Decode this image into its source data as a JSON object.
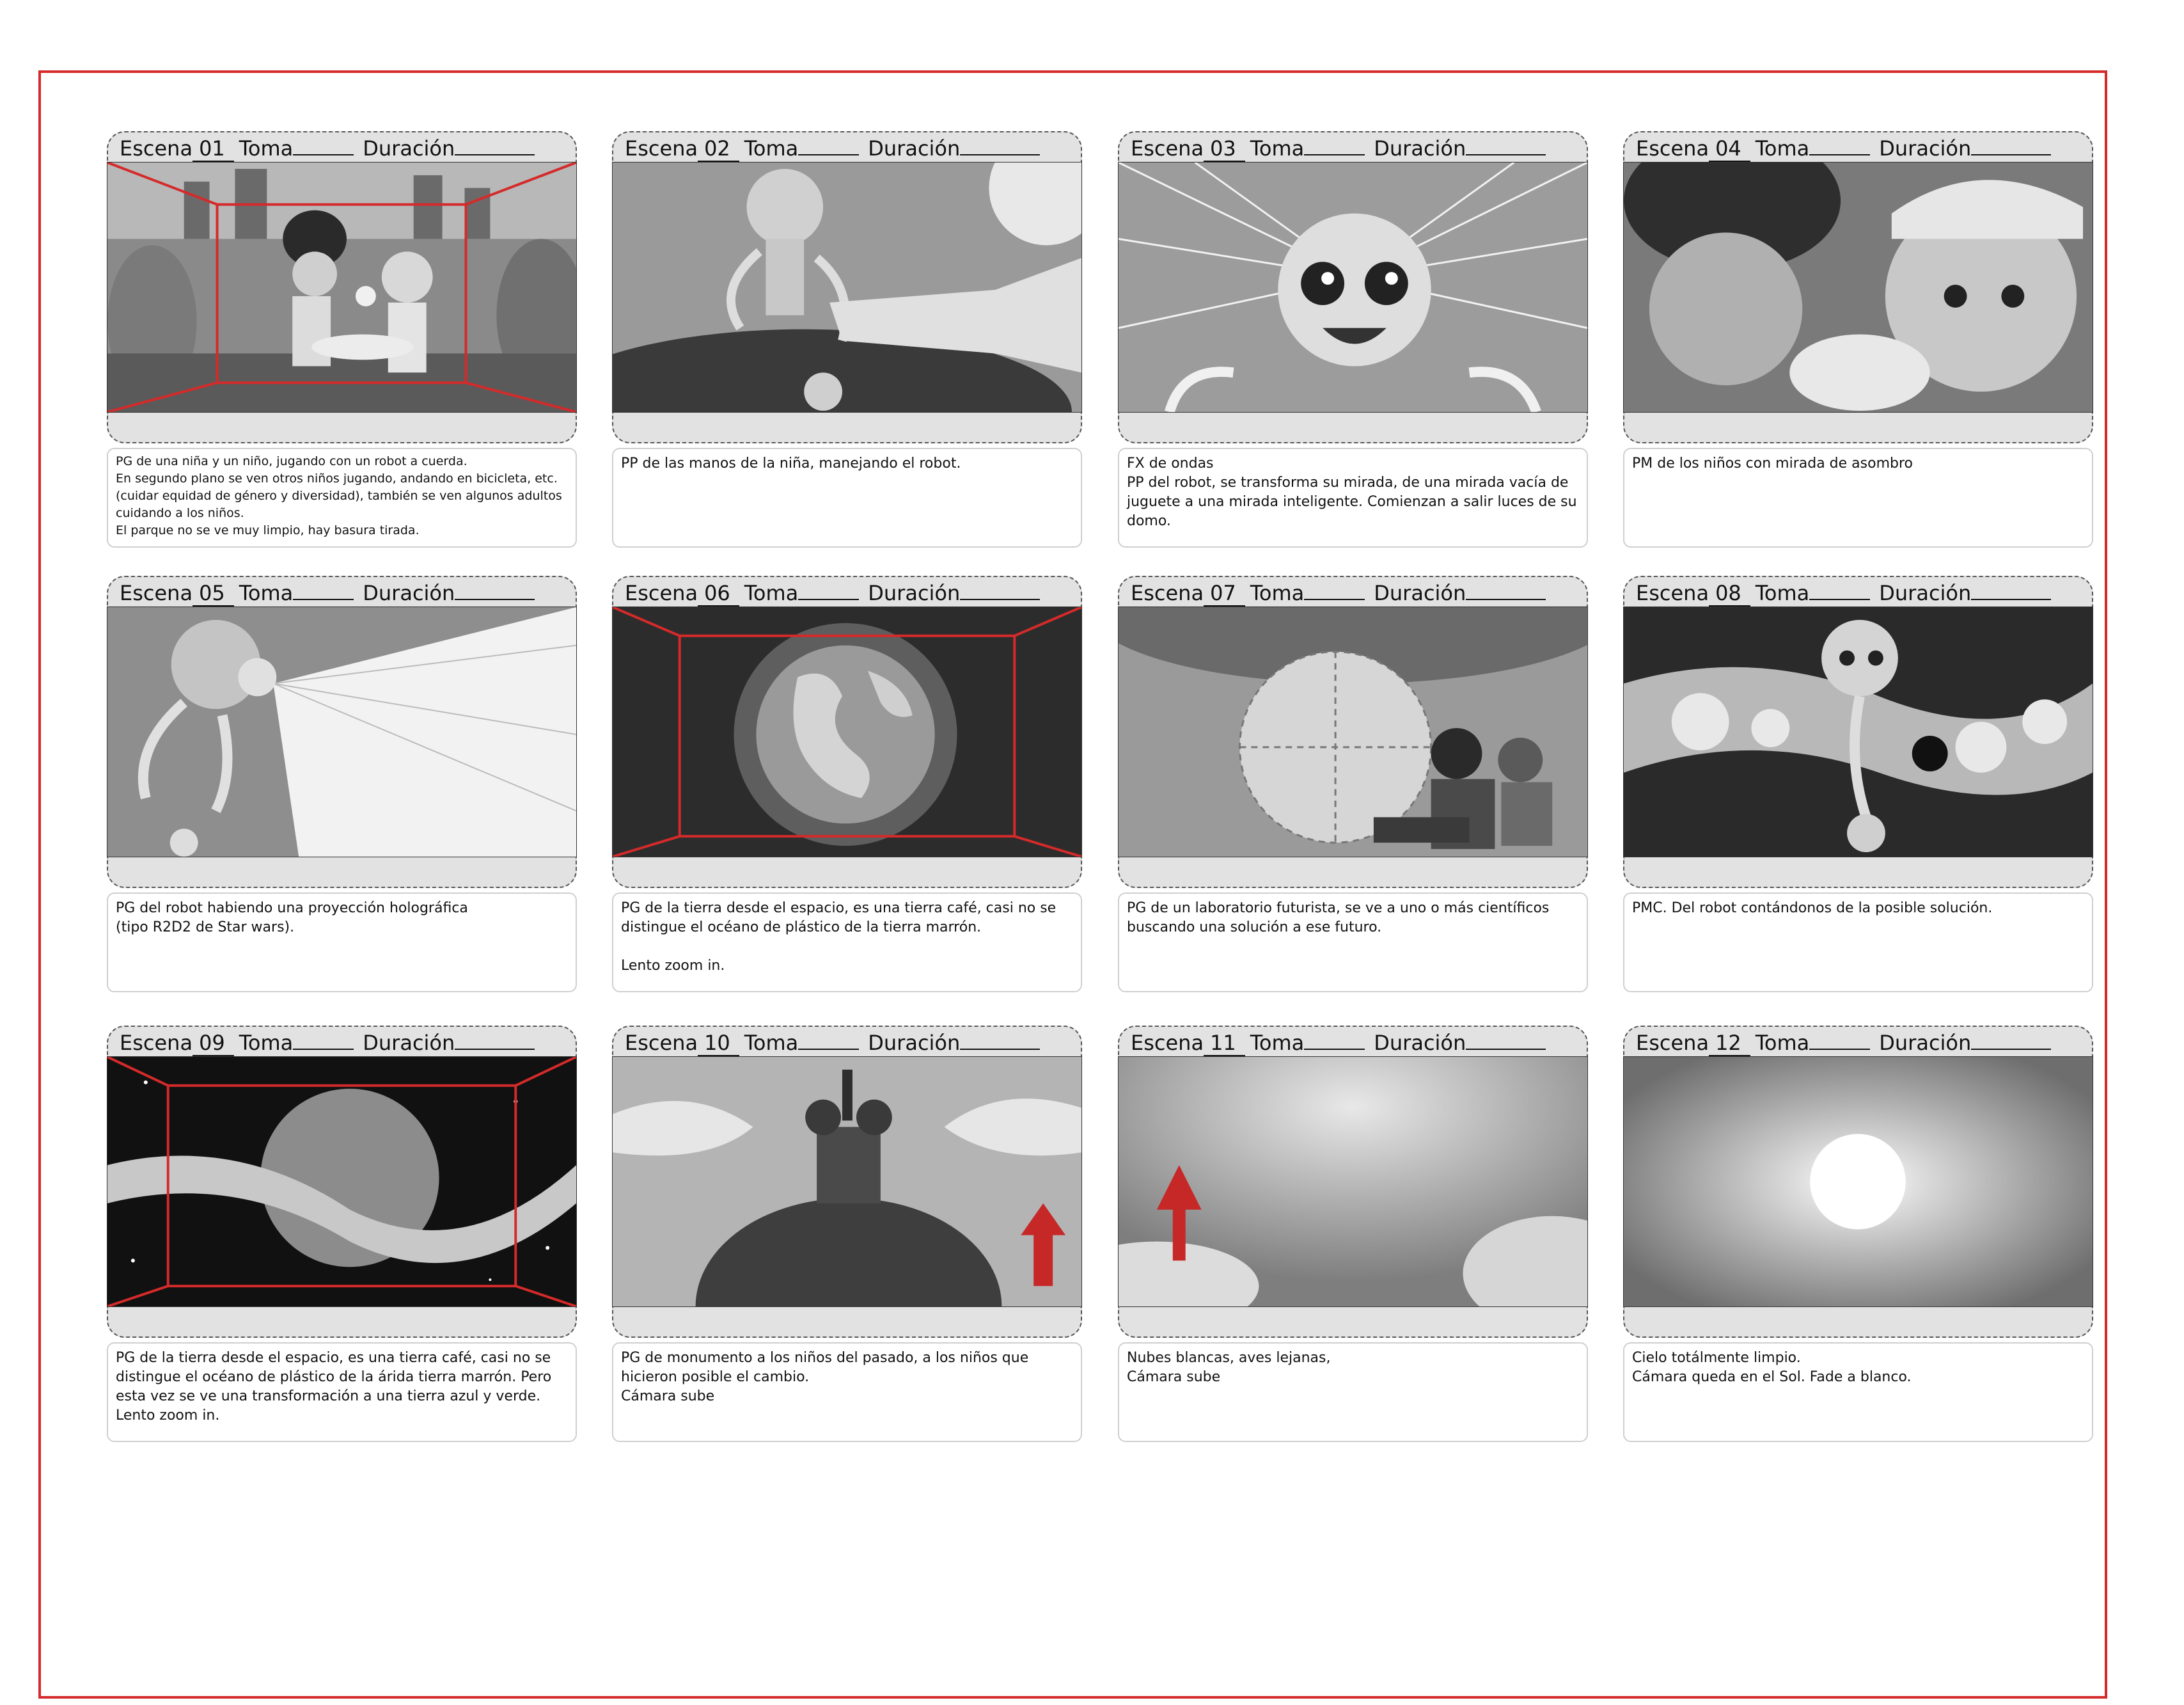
{
  "labels": {
    "escena": "Escena",
    "toma": "Toma",
    "duracion": "Duración"
  },
  "scenes": [
    {
      "num": "01",
      "desc": "PG de una niña y un niño, jugando con un robot a cuerda.\nEn segundo plano se ven otros niños jugando, andando en bicicleta, etc.\n(cuidar equidad de género y diversidad), también se ven algunos adultos\ncuidando a los niños.\nEl parque no se ve muy limpio, hay basura tirada."
    },
    {
      "num": "02",
      "desc": "PP de las manos de la niña, manejando el robot."
    },
    {
      "num": "03",
      "desc": "FX de ondas\nPP del robot, se transforma su mirada, de una mirada vacía de juguete a una mirada inteligente. Comienzan a salir luces de su domo."
    },
    {
      "num": "04",
      "desc": "PM de los niños con mirada de asombro"
    },
    {
      "num": "05",
      "desc": "PG del robot habiendo una proyección holográfica\n(tipo R2D2 de Star wars)."
    },
    {
      "num": "06",
      "desc": "PG de la tierra desde el espacio, es una tierra café, casi no se distingue el océano de plástico de la tierra marrón.\n\nLento zoom in."
    },
    {
      "num": "07",
      "desc": "PG de un laboratorio futurista, se ve a uno o más científicos buscando una solución a ese futuro."
    },
    {
      "num": "08",
      "desc": "PMC. Del robot contándonos de la posible solución."
    },
    {
      "num": "09",
      "desc": "PG de la tierra desde el espacio, es una tierra café, casi no se distingue el océano de plástico de la árida tierra marrón. Pero esta vez se ve una transformación a una tierra azul y verde.\nLento zoom in."
    },
    {
      "num": "10",
      "desc": "PG  de monumento  a los niños del pasado, a los niños que hicieron posible el cambio.\nCámara sube"
    },
    {
      "num": "11",
      "desc": "Nubes blancas, aves lejanas,\nCámara sube"
    },
    {
      "num": "12",
      "desc": "Cielo totálmente limpio.\nCámara queda en el Sol. Fade a blanco."
    }
  ],
  "colors": {
    "border_red": "#d52a2a",
    "panel_gray": "#e2e2e2",
    "arrow_red": "#c62828"
  }
}
